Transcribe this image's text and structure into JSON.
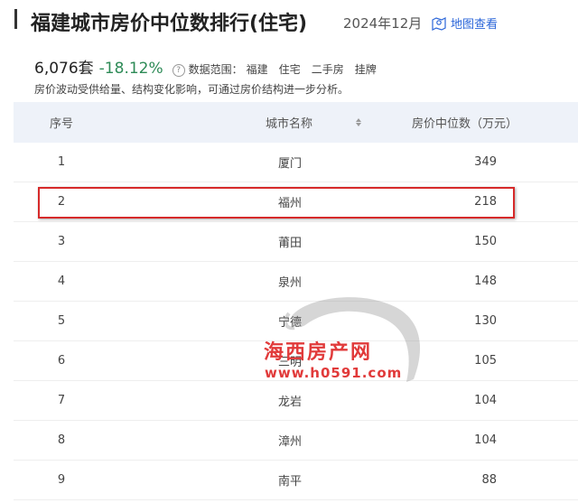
{
  "header": {
    "title": "福建城市房价中位数排行(住宅)",
    "date": "2024年12月",
    "map_link": "地图查看"
  },
  "summary": {
    "total": "6,076套",
    "change": "-18.12%",
    "scope_label": "数据范围：",
    "scope_tags": [
      "福建",
      "住宅",
      "二手房",
      "挂牌"
    ],
    "note": "房价波动受供给量、结构变化影响，可通过房价结构进一步分析。"
  },
  "table": {
    "headers": {
      "index": "序号",
      "city": "城市名称",
      "price": "房价中位数（万元）"
    },
    "rows": [
      {
        "index": "1",
        "city": "厦门",
        "price": "349"
      },
      {
        "index": "2",
        "city": "福州",
        "price": "218"
      },
      {
        "index": "3",
        "city": "莆田",
        "price": "150"
      },
      {
        "index": "4",
        "city": "泉州",
        "price": "148"
      },
      {
        "index": "5",
        "city": "宁德",
        "price": "130"
      },
      {
        "index": "6",
        "city": "三明",
        "price": "105"
      },
      {
        "index": "7",
        "city": "龙岩",
        "price": "104"
      },
      {
        "index": "8",
        "city": "漳州",
        "price": "104"
      },
      {
        "index": "9",
        "city": "南平",
        "price": "88"
      }
    ]
  },
  "watermark": {
    "name": "海西房产网",
    "url": "www.h0591.com"
  },
  "colors": {
    "positive_change": "#2e8b57",
    "link": "#2b66d9",
    "highlight_border": "#d62a2a",
    "header_bg": "#eef2f9",
    "watermark": "#e13a3a"
  }
}
